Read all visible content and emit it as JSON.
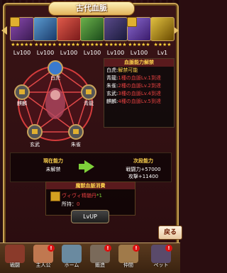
{
  "header": {
    "title": "古代血脈"
  },
  "portraits": [
    {
      "level": "Lv100",
      "stars": "★★★★★",
      "locked": true,
      "color": "#6a3a8a"
    },
    {
      "level": "Lv100",
      "stars": "★★★★★",
      "locked": false,
      "color": "#3a6a9a"
    },
    {
      "level": "Lv100",
      "stars": "★★★★★",
      "locked": false,
      "color": "#c23a3a"
    },
    {
      "level": "Lv100",
      "stars": "★★★★★",
      "locked": false,
      "color": "#3a7a3a"
    },
    {
      "level": "Lv100",
      "stars": "★★★★★",
      "locked": false,
      "color": "#4a3a6a"
    },
    {
      "level": "Lv100",
      "stars": "★★★★★",
      "locked": true,
      "color": "#6a4ab0"
    },
    {
      "level": "Lv1",
      "stars": "★★★★",
      "locked": false,
      "color": "#c4a020"
    }
  ],
  "bloodline_nodes": {
    "top": "白虎",
    "left": "麒麟",
    "right": "青龍",
    "bottom_left": "玄武",
    "bottom_right": "朱雀"
  },
  "info_panel": {
    "title": "血脈能力解禁",
    "rows": [
      {
        "key": "白虎:",
        "value": "解禁可能",
        "ok": true
      },
      {
        "key": "青龍:",
        "value": "1種の血脈Lv.1到達",
        "ok": false
      },
      {
        "key": "朱雀:",
        "value": "2種の血脈Lv.2到達",
        "ok": false
      },
      {
        "key": "玄武:",
        "value": "3種の血脈Lv.4到達",
        "ok": false
      },
      {
        "key": "麒麟:",
        "value": "4種の血脈Lv.5到達",
        "ok": false
      }
    ]
  },
  "stats": {
    "current_label": "現在能力",
    "current_value": "未解禁",
    "next_label": "次段能力",
    "next_line1": "戦闘力+57000",
    "next_line2": "攻撃+11400"
  },
  "material": {
    "title": "魔獣血脈消費",
    "item_name": "ヴィヴィ精髄丹",
    "item_count": "*1",
    "owned_label": "所持：",
    "owned_value": "0"
  },
  "buttons": {
    "lvup": "LvUP",
    "back": "戻る"
  },
  "tabs": [
    {
      "label": "戦闘",
      "alert": "!"
    },
    {
      "label": "主人公",
      "alert": "!"
    },
    {
      "label": "ホーム",
      "alert": ""
    },
    {
      "label": "鍛造",
      "alert": "!"
    },
    {
      "label": "仲間",
      "alert": "!"
    },
    {
      "label": "ペット",
      "alert": "!"
    }
  ]
}
